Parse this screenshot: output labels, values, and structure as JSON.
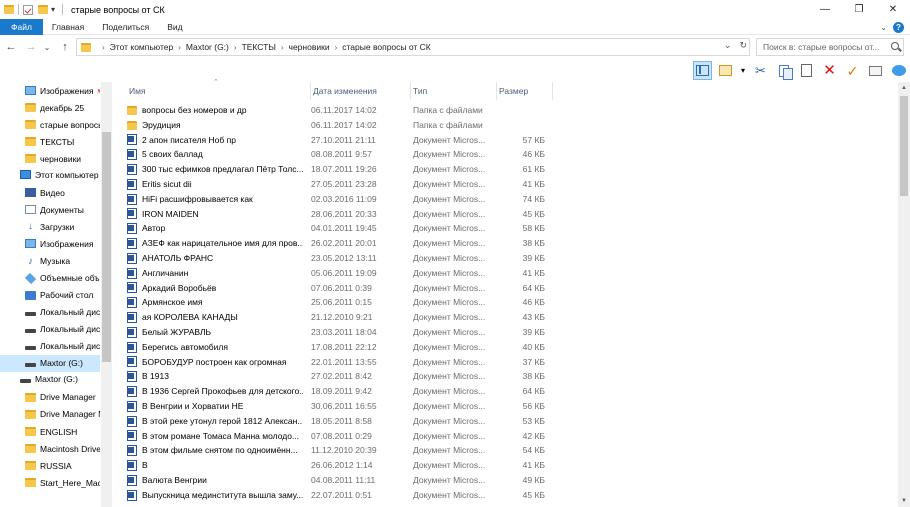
{
  "window": {
    "title": "старые вопросы от СК",
    "controls": {
      "minimize": "—",
      "maximize": "❐",
      "close": "✕"
    }
  },
  "ribbon": {
    "tabs": [
      "Файл",
      "Главная",
      "Поделиться",
      "Вид"
    ]
  },
  "address": {
    "breadcrumbs": [
      "Этот компьютер",
      "Maxtor (G:)",
      "ТЕКСТЫ",
      "черновики",
      "старые вопросы от СК"
    ],
    "search_placeholder": "Поиск в: старые вопросы от..."
  },
  "navigation": [
    {
      "label": "Изображения",
      "icon": "images-icon",
      "pinned": true
    },
    {
      "label": "декабрь 25",
      "icon": "folder-icon"
    },
    {
      "label": "старые вопросы",
      "icon": "folder-icon"
    },
    {
      "label": "ТЕКСТЫ",
      "icon": "folder-icon"
    },
    {
      "label": "черновики",
      "icon": "folder-icon"
    },
    {
      "label": "Этот компьютер",
      "icon": "computer-icon"
    },
    {
      "label": "Видео",
      "icon": "video-icon"
    },
    {
      "label": "Документы",
      "icon": "documents-icon"
    },
    {
      "label": "Загрузки",
      "icon": "downloads-icon"
    },
    {
      "label": "Изображения",
      "icon": "images-icon"
    },
    {
      "label": "Музыка",
      "icon": "music-icon"
    },
    {
      "label": "Объемные объ",
      "icon": "3d-objects-icon"
    },
    {
      "label": "Рабочий стол",
      "icon": "desktop-icon"
    },
    {
      "label": "Локальный дис",
      "icon": "drive-icon"
    },
    {
      "label": "Локальный дис",
      "icon": "drive-icon"
    },
    {
      "label": "Локальный дис",
      "icon": "drive-icon"
    },
    {
      "label": "Maxtor (G:)",
      "icon": "drive-icon",
      "selected": true
    },
    {
      "label": "Maxtor (G:)",
      "icon": "drive-icon"
    },
    {
      "label": "Drive Manager",
      "icon": "folder-icon"
    },
    {
      "label": "Drive Manager M",
      "icon": "folder-icon"
    },
    {
      "label": "ENGLISH",
      "icon": "folder-icon"
    },
    {
      "label": "Macintosh Drive",
      "icon": "folder-icon"
    },
    {
      "label": "RUSSIA",
      "icon": "folder-icon"
    },
    {
      "label": "Start_Here_Mac.",
      "icon": "folder-icon"
    }
  ],
  "columns": {
    "name": "Имя",
    "date": "Дата изменения",
    "type": "Тип",
    "size": "Размер"
  },
  "files": [
    {
      "name": "вопросы без номеров и др",
      "date": "06.11.2017 14:02",
      "type": "Папка с файлами",
      "size": "",
      "kind": "folder"
    },
    {
      "name": "Эрудиция",
      "date": "06.11.2017 14:02",
      "type": "Папка с файлами",
      "size": "",
      "kind": "folder"
    },
    {
      "name": "2 апон писателя Ноб пр",
      "date": "27.10.2011 21:11",
      "type": "Документ Micros...",
      "size": "57 КБ",
      "kind": "doc"
    },
    {
      "name": "5 своих баллад",
      "date": "08.08.2011 9:57",
      "type": "Документ Micros...",
      "size": "46 КБ",
      "kind": "doc"
    },
    {
      "name": "300 тыс ефимков предлагал Пётр Толс...",
      "date": "18.07.2011 19:26",
      "type": "Документ Micros...",
      "size": "61 КБ",
      "kind": "doc"
    },
    {
      "name": "Eritis sicut dii",
      "date": "27.05.2011 23:28",
      "type": "Документ Micros...",
      "size": "41 КБ",
      "kind": "doc"
    },
    {
      "name": "HiFi расшифровывается как",
      "date": "02.03.2016 11:09",
      "type": "Документ Micros...",
      "size": "74 КБ",
      "kind": "doc"
    },
    {
      "name": "IRON MAIDEN",
      "date": "28.06.2011 20:33",
      "type": "Документ Micros...",
      "size": "45 КБ",
      "kind": "doc"
    },
    {
      "name": "Автор",
      "date": "04.01.2011 19:45",
      "type": "Документ Micros...",
      "size": "58 КБ",
      "kind": "doc"
    },
    {
      "name": "АЗЕФ как нарицательное имя для пров...",
      "date": "26.02.2011 20:01",
      "type": "Документ Micros...",
      "size": "38 КБ",
      "kind": "doc"
    },
    {
      "name": "АНАТОЛЬ ФРАНС",
      "date": "23.05.2012 13:11",
      "type": "Документ Micros...",
      "size": "39 КБ",
      "kind": "doc"
    },
    {
      "name": "Англичанин",
      "date": "05.06.2011 19:09",
      "type": "Документ Micros...",
      "size": "41 КБ",
      "kind": "doc"
    },
    {
      "name": "Аркадий Воробьёв",
      "date": "07.06.2011 0:39",
      "type": "Документ Micros...",
      "size": "64 КБ",
      "kind": "doc"
    },
    {
      "name": "Армянское имя",
      "date": "25.06.2011 0:15",
      "type": "Документ Micros...",
      "size": "46 КБ",
      "kind": "doc"
    },
    {
      "name": "ая КОРОЛЕВА КАНАДЫ",
      "date": "21.12.2010 9:21",
      "type": "Документ Micros...",
      "size": "43 КБ",
      "kind": "doc"
    },
    {
      "name": "Белый ЖУРАВЛЬ",
      "date": "23.03.2011 18:04",
      "type": "Документ Micros...",
      "size": "39 КБ",
      "kind": "doc"
    },
    {
      "name": "Берегись автомобиля",
      "date": "17.08.2011 22:12",
      "type": "Документ Micros...",
      "size": "40 КБ",
      "kind": "doc"
    },
    {
      "name": "БОРОБУДУР построен как огромная",
      "date": "22.01.2011 13:55",
      "type": "Документ Micros...",
      "size": "37 КБ",
      "kind": "doc"
    },
    {
      "name": "В 1913",
      "date": "27.02.2011 8:42",
      "type": "Документ Micros...",
      "size": "38 КБ",
      "kind": "doc"
    },
    {
      "name": "В 1936 Сергей Прокофьев для детского...",
      "date": "18.09.2011 9:42",
      "type": "Документ Micros...",
      "size": "64 КБ",
      "kind": "doc"
    },
    {
      "name": "В Венгрии и Хорватии НЕ",
      "date": "30.06.2011 16:55",
      "type": "Документ Micros...",
      "size": "56 КБ",
      "kind": "doc"
    },
    {
      "name": "В этой реке утонул герой 1812 Алексан...",
      "date": "18.05.2011 8:58",
      "type": "Документ Micros...",
      "size": "53 КБ",
      "kind": "doc"
    },
    {
      "name": "В этом романе Томаса Манна молодо...",
      "date": "07.08.2011 0:29",
      "type": "Документ Micros...",
      "size": "42 КБ",
      "kind": "doc"
    },
    {
      "name": "В этом фильме снятом по одноимённ...",
      "date": "11.12.2010 20:39",
      "type": "Документ Micros...",
      "size": "54 КБ",
      "kind": "doc"
    },
    {
      "name": "В",
      "date": "26.06.2012 1:14",
      "type": "Документ Micros...",
      "size": "41 КБ",
      "kind": "doc"
    },
    {
      "name": "Валюта Венгрии",
      "date": "04.08.2011 11:11",
      "type": "Документ Micros...",
      "size": "49 КБ",
      "kind": "doc"
    },
    {
      "name": "Выпускница мединститута вышла заму...",
      "date": "22.07.2011 0:51",
      "type": "Документ Micros...",
      "size": "45 КБ",
      "kind": "doc"
    }
  ]
}
